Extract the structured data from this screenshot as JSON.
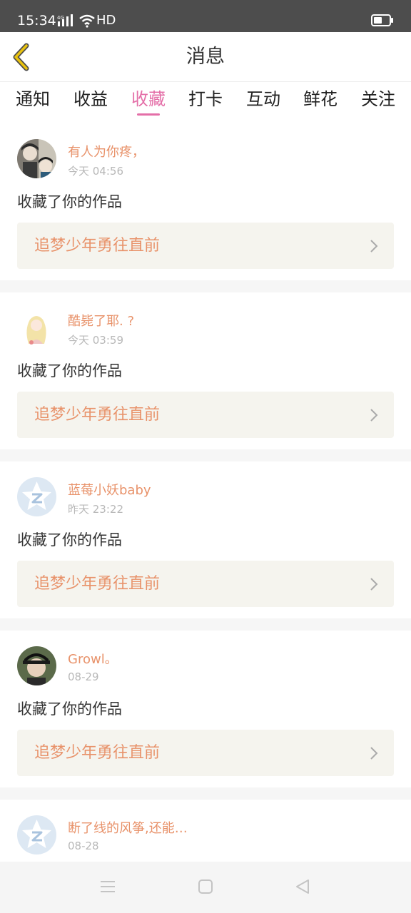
{
  "status_bar": {
    "time": "15:34",
    "network": "HD"
  },
  "header": {
    "title": "消息"
  },
  "tabs": [
    {
      "label": "通知"
    },
    {
      "label": "收益"
    },
    {
      "label": "收藏",
      "active": true
    },
    {
      "label": "打卡"
    },
    {
      "label": "互动"
    },
    {
      "label": "鲜花"
    },
    {
      "label": "关注"
    }
  ],
  "feed": [
    {
      "user": "有人为你疼，",
      "time": "今天 04:56",
      "action": "收藏了你的作品",
      "work": "追梦少年勇往直前",
      "avatar": "photo-avatar"
    },
    {
      "user": "酷毙了耶. ?",
      "time": "今天 03:59",
      "action": "收藏了你的作品",
      "work": "追梦少年勇往直前",
      "avatar": "illustration-avatar"
    },
    {
      "user": "蓝莓小妖baby",
      "time": "昨天 23:22",
      "action": "收藏了你的作品",
      "work": "追梦少年勇往直前",
      "avatar": "default-avatar"
    },
    {
      "user": "Growl。",
      "time": "08-29",
      "action": "收藏了你的作品",
      "work": "追梦少年勇往直前",
      "avatar": "photo-avatar"
    },
    {
      "user": "断了线的风筝,还能…",
      "time": "08-28",
      "action": "",
      "work": "",
      "avatar": "default-avatar"
    }
  ],
  "colors": {
    "accent": "#e46fa8",
    "name": "#e8926a",
    "back_arrow": "#e9c20e"
  }
}
